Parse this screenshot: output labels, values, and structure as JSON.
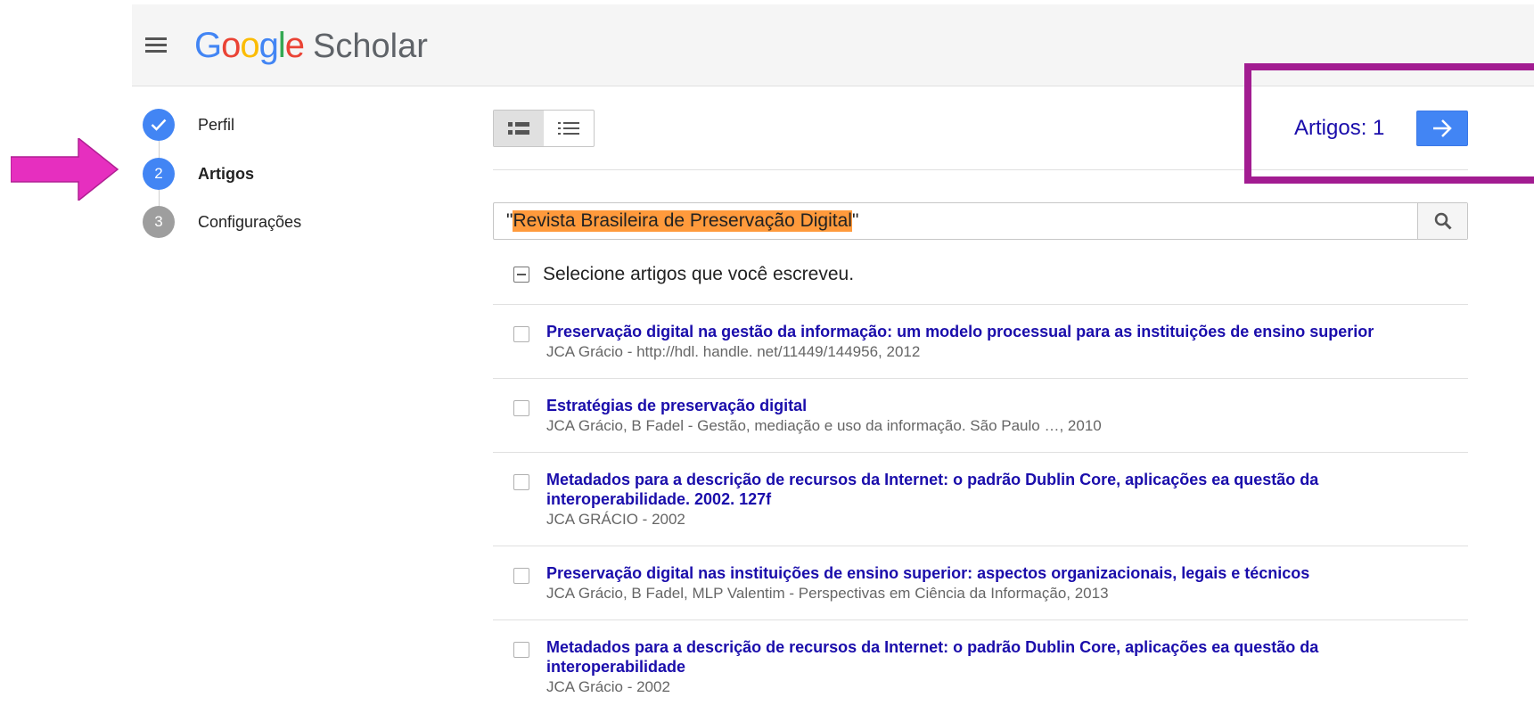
{
  "app": {
    "logo": {
      "letters": [
        "G",
        "o",
        "o",
        "g",
        "l",
        "e"
      ],
      "product": "Scholar"
    },
    "colors": {
      "blue": "#4285f4",
      "red": "#ea4335",
      "yellow": "#fbbc05",
      "green": "#34a853",
      "link": "#1a0dab",
      "annotation": "#a21c91",
      "arrow": "#e62fbf",
      "search_highlight": "#ff9a3c"
    }
  },
  "steps": [
    {
      "number": "1",
      "label": "Perfil",
      "state": "done",
      "icon": "check-icon"
    },
    {
      "number": "2",
      "label": "Artigos",
      "state": "active"
    },
    {
      "number": "3",
      "label": "Configurações",
      "state": "todo"
    }
  ],
  "toolbar": {
    "view_options": [
      {
        "name": "detailed-view-icon",
        "selected": true
      },
      {
        "name": "compact-list-view-icon",
        "selected": false
      }
    ]
  },
  "counter": {
    "text": "Artigos: 1",
    "next_icon": "arrow-right-icon"
  },
  "search": {
    "prefix": "\"",
    "highlighted": "Revista Brasileira de Preservação Digital",
    "suffix": "\"",
    "icon": "search-icon"
  },
  "select_all": {
    "label": "Selecione artigos que você escreveu.",
    "state": "partial"
  },
  "articles": [
    {
      "title": "Preservação digital na gestão da informação: um modelo processual para as instituições de ensino superior",
      "meta": "JCA Grácio - http://hdl. handle. net/11449/144956, 2012"
    },
    {
      "title": "Estratégias de preservação digital",
      "meta": "JCA Grácio, B Fadel - Gestão, mediação e uso da informação. São Paulo …, 2010"
    },
    {
      "title": "Metadados para a descrição de recursos da Internet: o padrão Dublin Core, aplicações ea questão da interoperabilidade. 2002. 127f",
      "meta": "JCA GRÁCIO - 2002"
    },
    {
      "title": "Preservação digital nas instituições de ensino superior: aspectos organizacionais, legais e técnicos",
      "meta": "JCA Grácio, B Fadel, MLP Valentim - Perspectivas em Ciência da Informação, 2013"
    },
    {
      "title": "Metadados para a descrição de recursos da Internet: o padrão Dublin Core, aplicações ea questão da interoperabilidade",
      "meta": "JCA Grácio - 2002"
    }
  ]
}
